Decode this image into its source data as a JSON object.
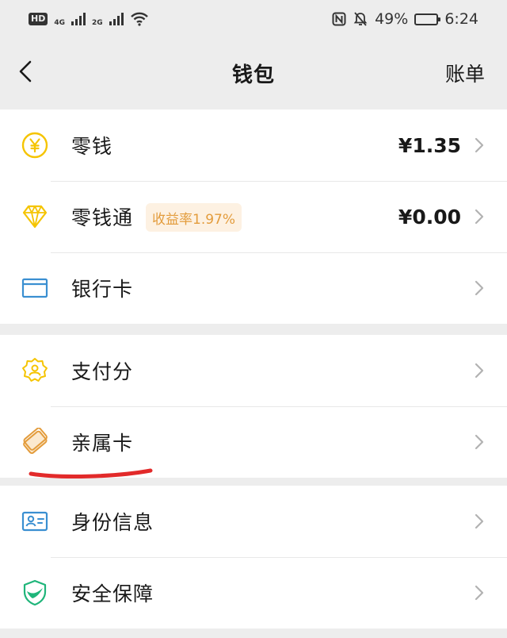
{
  "status_bar": {
    "hd": "HD",
    "net1": "4G",
    "net2": "2G",
    "battery_text": "49%",
    "battery_level": 0.49,
    "time": "6:24",
    "icons": [
      "nfc-icon",
      "bell-off-icon",
      "wifi-icon"
    ]
  },
  "nav": {
    "title": "钱包",
    "right_label": "账单"
  },
  "groups": [
    {
      "items": [
        {
          "label": "零钱",
          "value": "¥1.35",
          "icon": "yuan-coin-icon"
        },
        {
          "label": "零钱通",
          "badge": "收益率1.97%",
          "value": "¥0.00",
          "icon": "diamond-icon"
        },
        {
          "label": "银行卡",
          "icon": "bank-card-icon"
        }
      ]
    },
    {
      "items": [
        {
          "label": "支付分",
          "icon": "pay-score-icon"
        },
        {
          "label": "亲属卡",
          "icon": "family-card-icon"
        }
      ]
    },
    {
      "items": [
        {
          "label": "身份信息",
          "icon": "id-card-icon"
        },
        {
          "label": "安全保障",
          "icon": "shield-check-icon"
        }
      ]
    }
  ],
  "colors": {
    "accent_yellow": "#f5c400",
    "accent_blue": "#3a8fd1",
    "accent_green": "#1fb57a",
    "badge_bg": "#fdf1e2",
    "badge_text": "#e39c3c",
    "annotation_red": "#e22a2a"
  }
}
